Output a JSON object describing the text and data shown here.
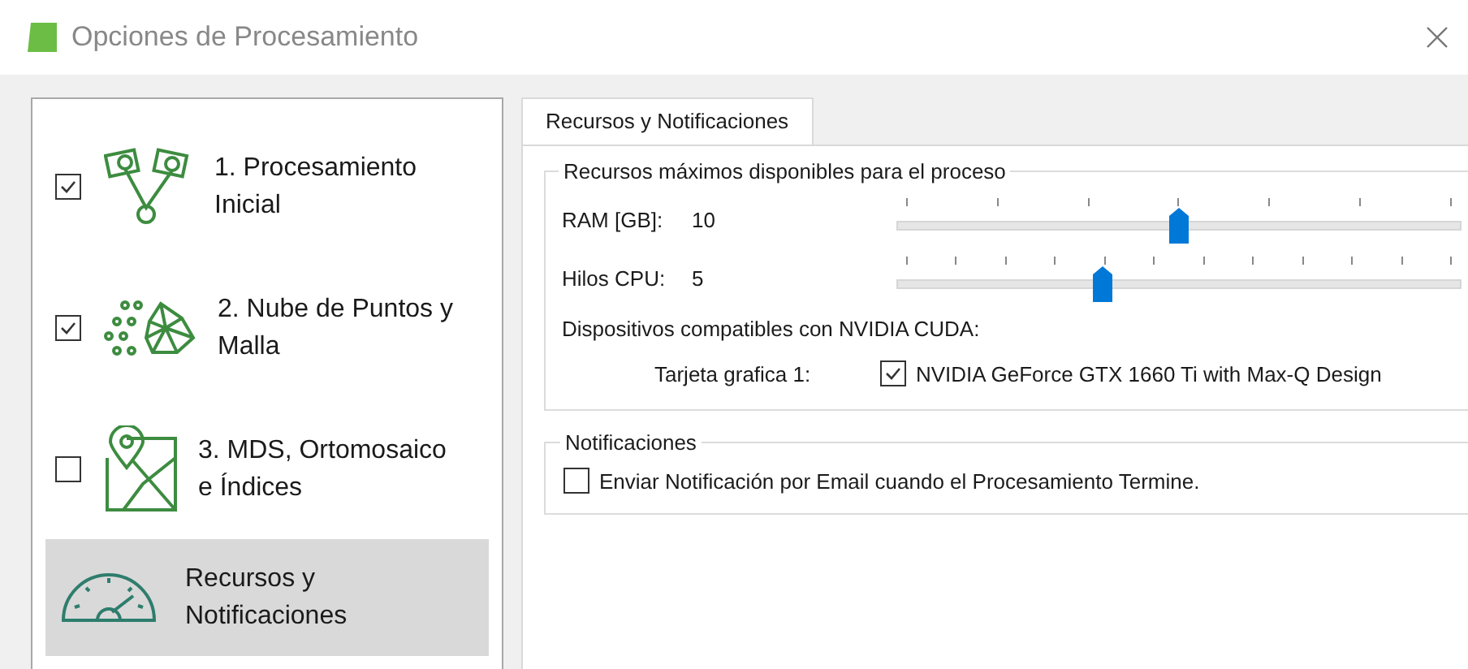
{
  "window": {
    "title": "Opciones de Procesamiento"
  },
  "sidebar": {
    "items": [
      {
        "kind": "cameras",
        "label": "1. Procesamiento Inicial",
        "checked": true,
        "selected": false
      },
      {
        "kind": "pointcloud",
        "label": "2. Nube de Puntos y Malla",
        "checked": true,
        "selected": false
      },
      {
        "kind": "map",
        "label": "3. MDS, Ortomosaico e Índices",
        "checked": false,
        "selected": false
      },
      {
        "kind": "gauge",
        "label": "Recursos y Notificaciones",
        "selected": true
      }
    ]
  },
  "tabs": [
    {
      "label": "Recursos y Notificaciones",
      "selected": true
    }
  ],
  "resources": {
    "title": "Recursos máximos disponibles para el proceso",
    "sliders": [
      {
        "label": "RAM [GB]:",
        "reading": "10",
        "level": 0.5
      },
      {
        "label": "Hilos CPU:",
        "reading": "5",
        "level": 0.364
      }
    ],
    "cuda_label": "Dispositivos compatibles con NVIDIA CUDA:",
    "gpus": [
      {
        "label": "Tarjeta grafica 1:",
        "name": "NVIDIA GeForce GTX 1660 Ti with Max-Q Design",
        "checked": true
      }
    ]
  },
  "notifications": {
    "title": "Notificaciones",
    "options": [
      {
        "label": "Enviar Notificación por Email cuando el Procesamiento Termine.",
        "checked": false
      }
    ]
  }
}
